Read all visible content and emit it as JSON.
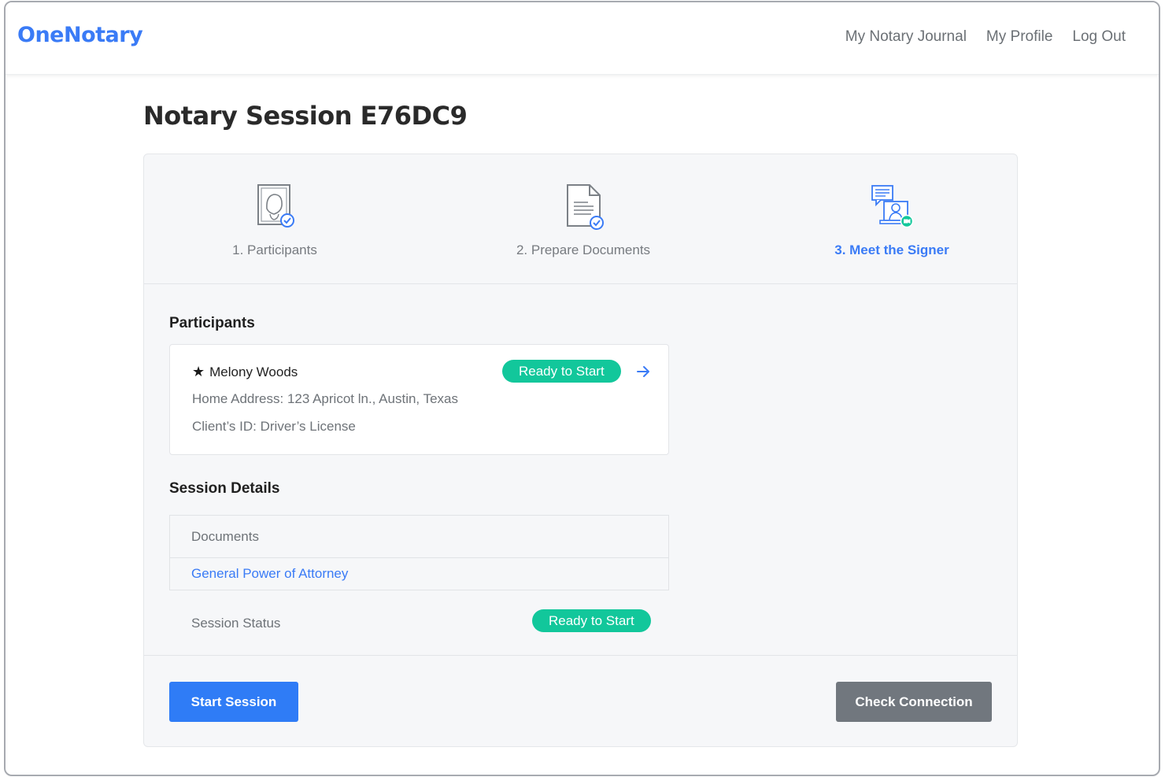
{
  "app": {
    "logo": "OneNotary"
  },
  "nav": {
    "journal": "My Notary Journal",
    "profile": "My Profile",
    "logout": "Log Out"
  },
  "page": {
    "title": "Notary Session E76DC9"
  },
  "steps": [
    {
      "label": "1. Participants",
      "icon": "participant-id-check-icon",
      "state": "done"
    },
    {
      "label": "2. Prepare Documents",
      "icon": "document-check-icon",
      "state": "done"
    },
    {
      "label": "3. Meet the Signer",
      "icon": "video-meeting-icon",
      "state": "active"
    }
  ],
  "participants": {
    "heading": "Participants",
    "items": [
      {
        "name": "Melony Woods",
        "address": "Home Address: 123 Apricot ln., Austin, Texas",
        "client_id": "Client’s ID: Driver’s License",
        "status": "Ready to Start"
      }
    ]
  },
  "session": {
    "heading": "Session Details",
    "documents_header": "Documents",
    "documents": [
      "General Power of Attorney"
    ],
    "status_label": "Session Status",
    "status": "Ready to Start"
  },
  "actions": {
    "start": "Start Session",
    "check": "Check Connection"
  },
  "colors": {
    "accent": "#3a7bf6",
    "success": "#12c79b",
    "secondary": "#71777e"
  }
}
